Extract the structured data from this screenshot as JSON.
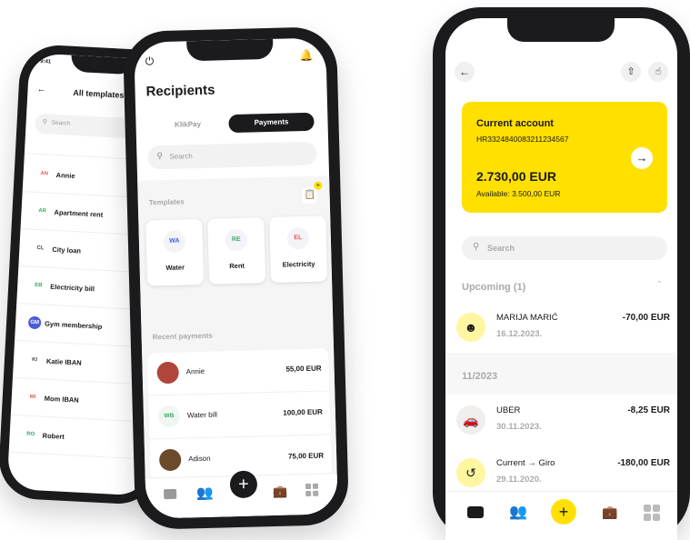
{
  "phone1": {
    "status_time": "9:41",
    "title": "All templates",
    "search_placeholder": "Search",
    "templates": [
      {
        "badge": "AN",
        "name": "Annie",
        "color": "#e25b5b"
      },
      {
        "badge": "AR",
        "name": "Apartment rent",
        "color": "#3aa768"
      },
      {
        "badge": "CL",
        "name": "City loan",
        "color": "#444444"
      },
      {
        "badge": "EB",
        "name": "Electricity bill",
        "color": "#3aa768"
      },
      {
        "badge": "GM",
        "name": "Gym membership",
        "color": "#ffffff"
      },
      {
        "badge": "KI",
        "name": "Katie IBAN",
        "color": "#444444"
      },
      {
        "badge": "MI",
        "name": "Mom IBAN",
        "color": "#e25b5b"
      },
      {
        "badge": "RO",
        "name": "Robert",
        "color": "#3aa768"
      }
    ]
  },
  "phone2": {
    "title": "Recipients",
    "tabs": [
      "KlikPay",
      "Payments"
    ],
    "search_placeholder": "Search",
    "templates_label": "Templates",
    "template_cards": [
      {
        "badge": "WA",
        "name": "Water",
        "color": "#4b5bd6"
      },
      {
        "badge": "RE",
        "name": "Rent",
        "color": "#3aa768"
      },
      {
        "badge": "EL",
        "name": "Electricity",
        "color": "#e25b5b"
      }
    ],
    "recent_label": "Recent payments",
    "payments": [
      {
        "avatar": "photo",
        "name": "Annie",
        "amount": "55,00 EUR"
      },
      {
        "avatar": "WB",
        "name": "Water bill",
        "amount": "100,00 EUR"
      },
      {
        "avatar": "photo",
        "name": "Adison",
        "amount": "75,00 EUR"
      }
    ]
  },
  "phone3": {
    "account": {
      "name": "Current account",
      "iban": "HR3324840083211234567",
      "balance": "2.730,00 EUR",
      "available": "Available: 3.500,00 EUR"
    },
    "search_placeholder": "Search",
    "upcoming_label": "Upcoming (1)",
    "month_label": "11/2023",
    "transactions": [
      {
        "name": "MARIJA MARIĆ",
        "date": "16.12.2023.",
        "amount": "-70,00 EUR"
      },
      {
        "name": "UBER",
        "date": "30.11.2023.",
        "amount": "-8,25 EUR"
      },
      {
        "name": "Current → Giro",
        "date": "29.11.2020.",
        "amount": "-180,00 EUR"
      }
    ]
  },
  "colors": {
    "accent": "#ffe000",
    "dark": "#1b1b1d"
  }
}
